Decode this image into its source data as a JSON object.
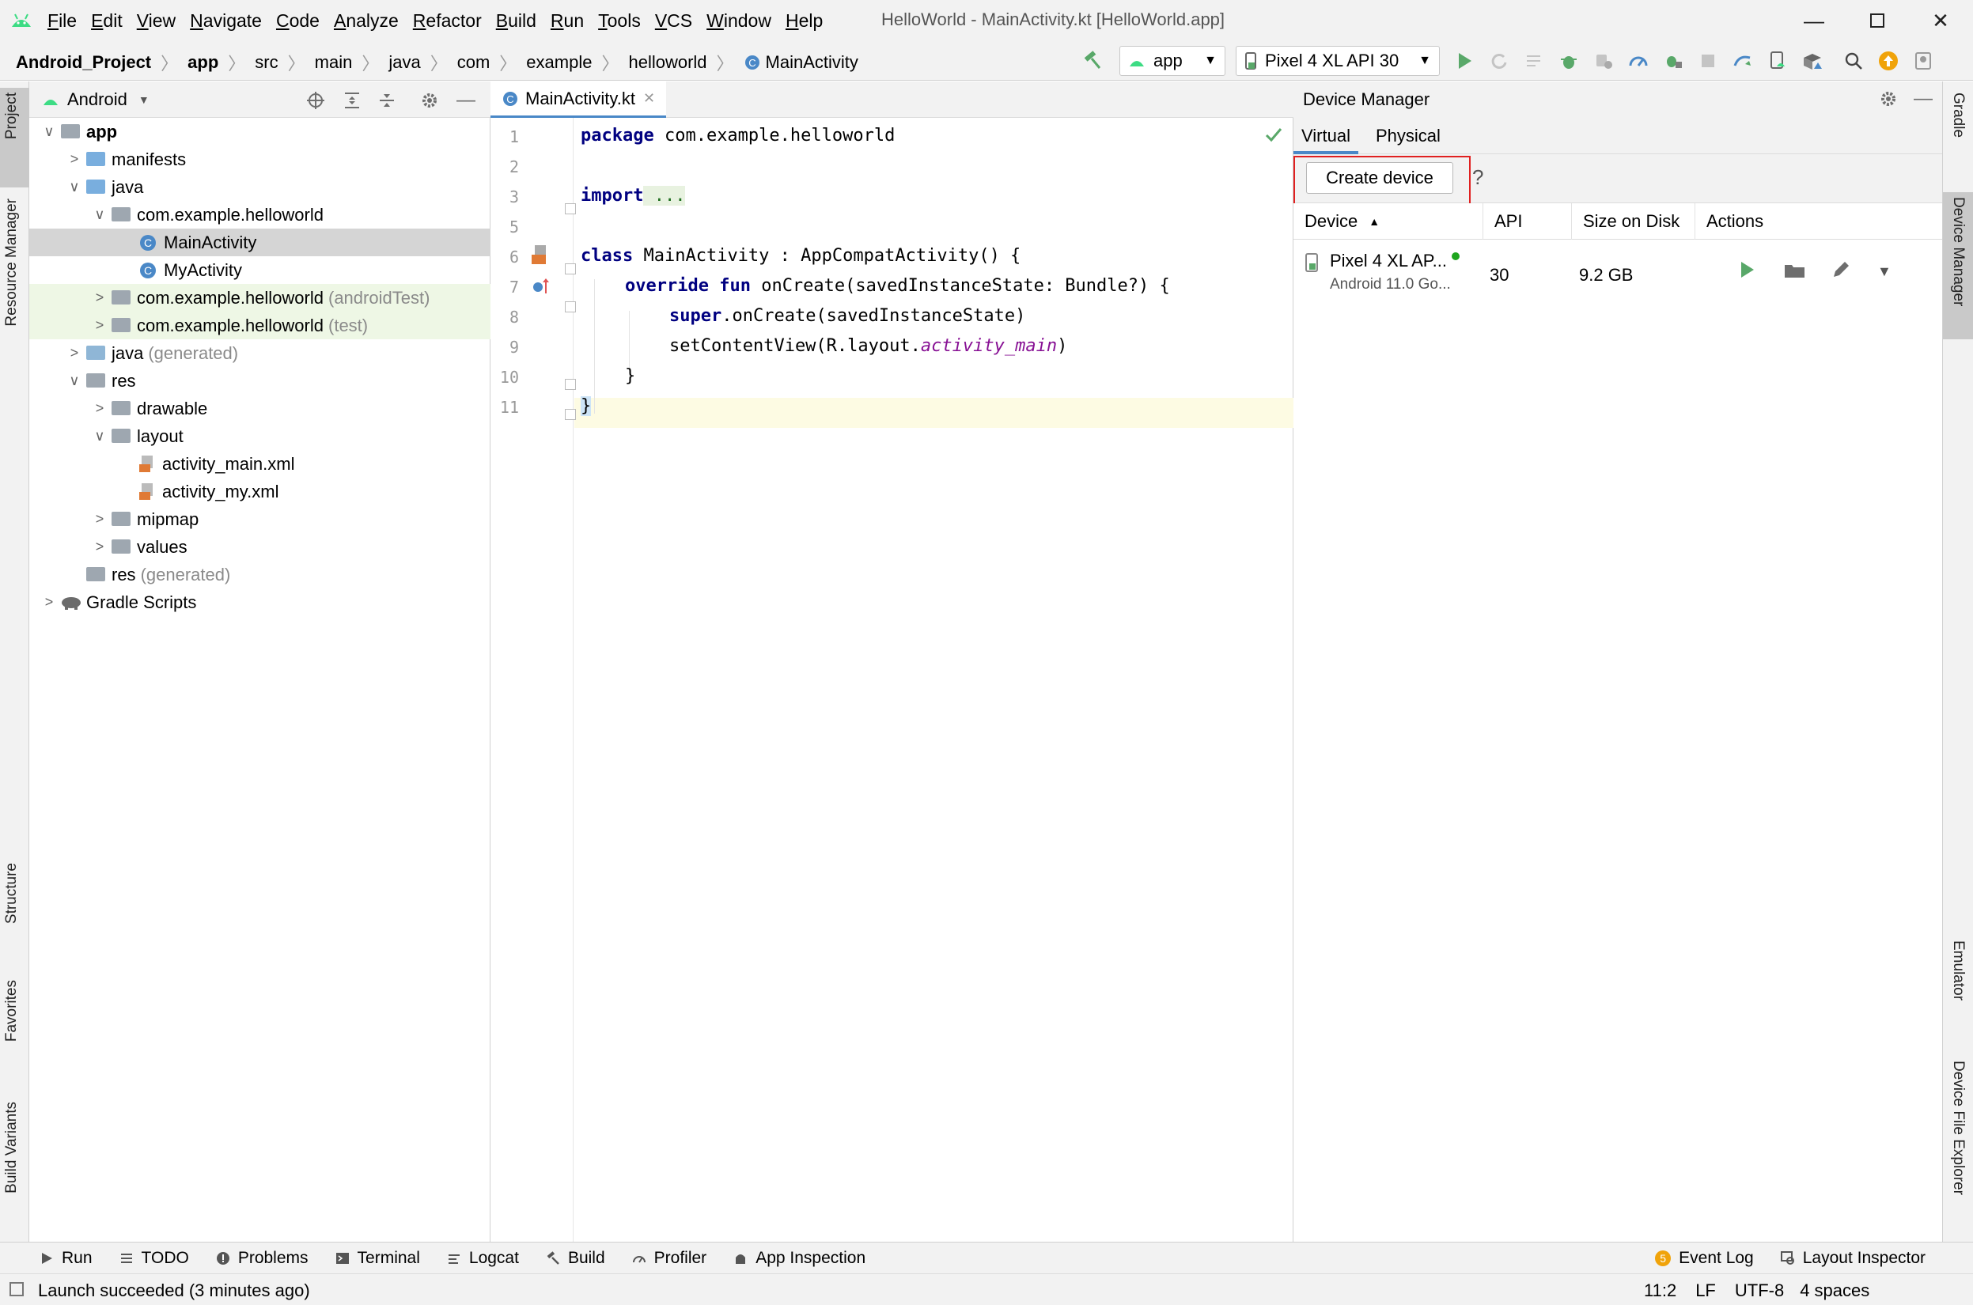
{
  "menubar": {
    "items": [
      "File",
      "Edit",
      "View",
      "Navigate",
      "Code",
      "Analyze",
      "Refactor",
      "Build",
      "Run",
      "Tools",
      "VCS",
      "Window",
      "Help"
    ],
    "title": "HelloWorld - MainActivity.kt [HelloWorld.app]"
  },
  "navbar": {
    "breadcrumbs": [
      "Android_Project",
      "app",
      "src",
      "main",
      "java",
      "com",
      "example",
      "helloworld",
      "MainActivity"
    ],
    "run_config": "app",
    "device": "Pixel 4 XL API 30"
  },
  "left_strip": {
    "tabs": [
      "Project",
      "Resource Manager",
      "Structure",
      "Favorites",
      "Build Variants"
    ]
  },
  "right_strip": {
    "tabs": [
      "Gradle",
      "Device Manager",
      "Emulator",
      "Device File Explorer"
    ]
  },
  "project": {
    "view": "Android",
    "tree": [
      {
        "label": "app",
        "suffix": ""
      },
      {
        "label": "manifests",
        "suffix": ""
      },
      {
        "label": "java",
        "suffix": ""
      },
      {
        "label": "com.example.helloworld",
        "suffix": ""
      },
      {
        "label": "MainActivity",
        "suffix": ""
      },
      {
        "label": "MyActivity",
        "suffix": ""
      },
      {
        "label": "com.example.helloworld",
        "suffix": "(androidTest)"
      },
      {
        "label": "com.example.helloworld",
        "suffix": "(test)"
      },
      {
        "label": "java",
        "suffix": "(generated)"
      },
      {
        "label": "res",
        "suffix": ""
      },
      {
        "label": "drawable",
        "suffix": ""
      },
      {
        "label": "layout",
        "suffix": ""
      },
      {
        "label": "activity_main.xml",
        "suffix": ""
      },
      {
        "label": "activity_my.xml",
        "suffix": ""
      },
      {
        "label": "mipmap",
        "suffix": ""
      },
      {
        "label": "values",
        "suffix": ""
      },
      {
        "label": "res",
        "suffix": "(generated)"
      },
      {
        "label": "Gradle Scripts",
        "suffix": ""
      }
    ]
  },
  "editor": {
    "tab": "MainActivity.kt",
    "line_numbers": [
      "1",
      "2",
      "3",
      "5",
      "6",
      "7",
      "8",
      "9",
      "10",
      "11"
    ],
    "code": {
      "l1_kw": "package",
      "l1_rest": " com.example.helloworld",
      "l3_kw": "import",
      "l3_rest": " ...",
      "l6_kw": "class",
      "l6_rest": " MainActivity : AppCompatActivity() {",
      "l7_kw1": "override",
      "l7_kw2": " fun",
      "l7_rest": " onCreate(savedInstanceState: Bundle?) {",
      "l8_kw": "super",
      "l8_rest": ".onCreate(savedInstanceState)",
      "l9_pre": "setContentView(R.layout.",
      "l9_it": "activity_main",
      "l9_post": ")",
      "l10": "}",
      "l11": "}"
    }
  },
  "device_manager": {
    "title": "Device Manager",
    "tabs": [
      "Virtual",
      "Physical"
    ],
    "create_button": "Create device",
    "help": "?",
    "columns": [
      "Device",
      "API",
      "Size on Disk",
      "Actions"
    ],
    "devices": [
      {
        "name": "Pixel 4 XL AP...",
        "os": "Android 11.0 Go...",
        "api": "30",
        "size": "9.2 GB"
      }
    ],
    "highlight_color": "#e02020"
  },
  "toolwindows": {
    "left": [
      "Run",
      "TODO",
      "Problems",
      "Terminal",
      "Logcat",
      "Build",
      "Profiler",
      "App Inspection"
    ],
    "right": [
      "Event Log",
      "Layout Inspector"
    ],
    "event_count": "5"
  },
  "status": {
    "message": "Launch succeeded (3 minutes ago)",
    "position": "11:2",
    "line_sep": "LF",
    "encoding": "UTF-8",
    "indent": "4 spaces"
  },
  "colors": {
    "android_green": "#3ddc84",
    "run_green": "#59a869",
    "accent_blue": "#4a88c7"
  }
}
